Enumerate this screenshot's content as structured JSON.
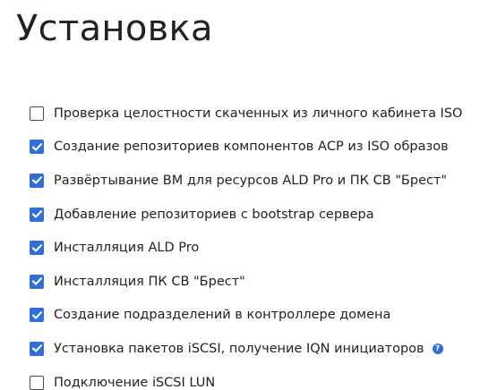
{
  "page": {
    "title": "Установка"
  },
  "steps": [
    {
      "label": "Проверка целостности скаченных из личного кабинета ISO",
      "checked": false
    },
    {
      "label": "Создание репозиториев компонентов АСР из ISO образов",
      "checked": true
    },
    {
      "label": "Развёртывание ВМ для ресурсов ALD Pro и ПК СВ \"Брест\"",
      "checked": true
    },
    {
      "label": "Добавление репозиториев с bootstrap сервера",
      "checked": true
    },
    {
      "label": "Инсталляция ALD Pro",
      "checked": true
    },
    {
      "label": "Инсталляция ПК СВ \"Брест\"",
      "checked": true
    },
    {
      "label": "Создание подразделений в контроллере домена",
      "checked": true
    },
    {
      "label": "Установка пакетов iSCSI, получение IQN инициаторов",
      "checked": true,
      "help_icon": "question-circle-icon",
      "help_glyph": "?"
    },
    {
      "label": "Подключение iSCSI LUN",
      "checked": false
    }
  ],
  "colors": {
    "accent": "#2f6fd6",
    "text": "#222222",
    "checkbox_border": "#4a4a4a"
  }
}
